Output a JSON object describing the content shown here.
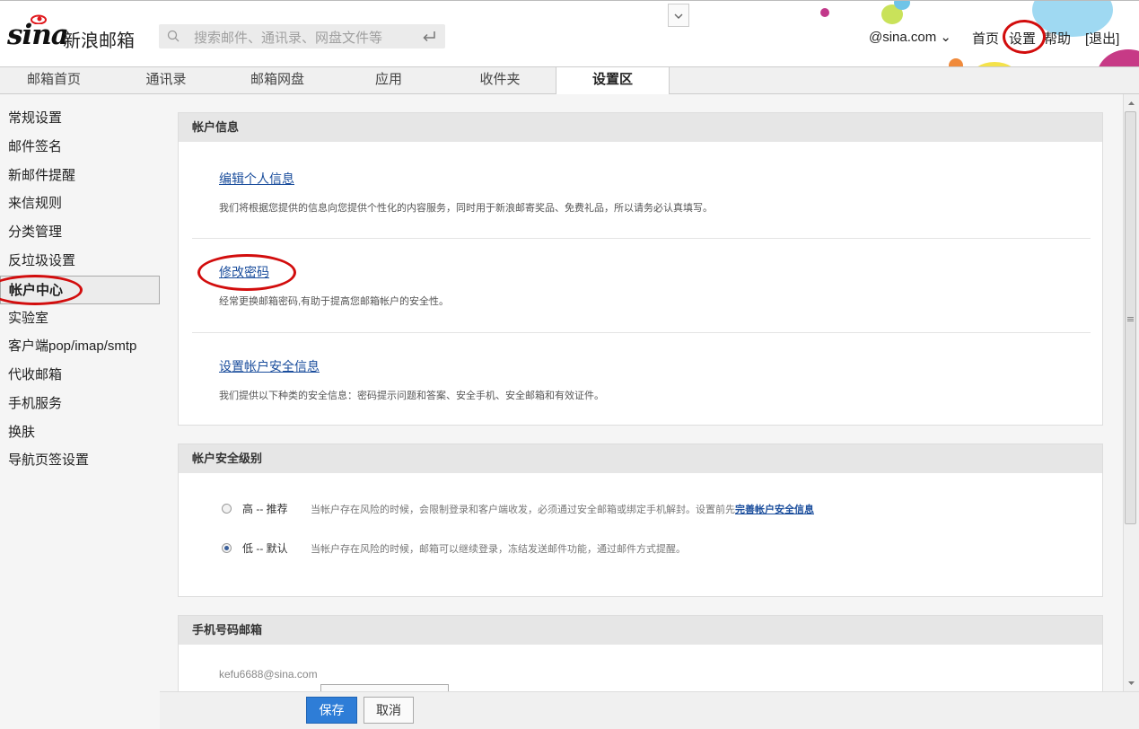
{
  "app": {
    "brand": "sina",
    "product": "新浪邮箱"
  },
  "search": {
    "placeholder": "搜索邮件、通讯录、网盘文件等"
  },
  "header": {
    "account": "@sina.com ⌄",
    "home": "首页",
    "settings": "设置",
    "help": "帮助",
    "logout": "[退出]"
  },
  "tabs": [
    {
      "label": "邮箱首页"
    },
    {
      "label": "通讯录"
    },
    {
      "label": "邮箱网盘"
    },
    {
      "label": "应用"
    },
    {
      "label": "收件夹"
    },
    {
      "label": "设置区",
      "active": true
    }
  ],
  "sidebar": {
    "items": [
      {
        "label": "常规设置"
      },
      {
        "label": "邮件签名"
      },
      {
        "label": "新邮件提醒"
      },
      {
        "label": "来信规则"
      },
      {
        "label": "分类管理"
      },
      {
        "label": "反垃圾设置"
      },
      {
        "label": "帐户中心",
        "active": true
      },
      {
        "label": "实验室"
      },
      {
        "label": "客户端pop/imap/smtp"
      },
      {
        "label": "代收邮箱"
      },
      {
        "label": "手机服务"
      },
      {
        "label": "换肤"
      },
      {
        "label": "导航页签设置"
      }
    ]
  },
  "account_info": {
    "title": "帐户信息",
    "edit_profile": {
      "link": "编辑个人信息",
      "desc": "我们将根据您提供的信息向您提供个性化的内容服务，同时用于新浪邮寄奖品、免费礼品，所以请务必认真填写。"
    },
    "change_password": {
      "link": "修改密码",
      "desc": "经常更换邮箱密码,有助于提高您邮箱帐户的安全性。"
    },
    "security_info": {
      "link": "设置帐户安全信息",
      "desc": "我们提供以下种类的安全信息：密码提示问题和答案、安全手机、安全邮箱和有效证件。"
    }
  },
  "security_level": {
    "title": "帐户安全级别",
    "high": {
      "label": "高 -- 推荐",
      "desc": "当帐户存在风险的时候，会限制登录和客户端收发，必须通过安全邮箱或绑定手机解封。设置前先",
      "link": "完善帐户安全信息",
      "selected": false
    },
    "low": {
      "label": "低 -- 默认",
      "desc": "当帐户存在风险的时候，邮箱可以继续登录，冻结发送邮件功能，通过邮件方式提醒。",
      "selected": true
    }
  },
  "mobile_mailbox": {
    "title": "手机号码邮箱",
    "email": "kefu6688@sina.com"
  },
  "footer": {
    "save": "保存",
    "cancel": "取消"
  },
  "colors": {
    "link": "#1a4d9c",
    "save_button": "#2e7dd7",
    "annotation_ring": "#d20d0d"
  }
}
